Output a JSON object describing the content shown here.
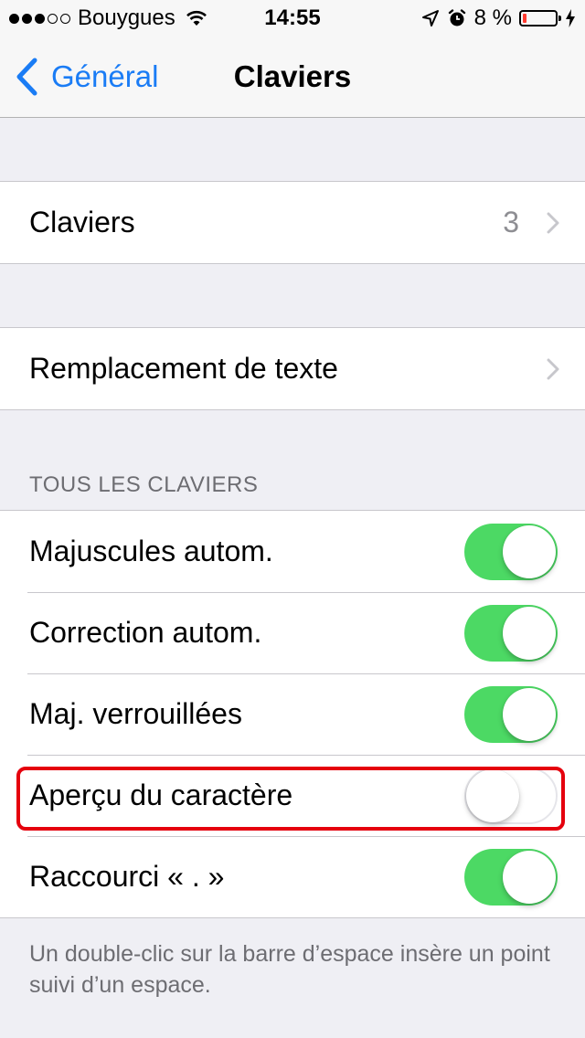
{
  "status_bar": {
    "carrier": "Bouygues",
    "signal_icon": "signal-dots-icon",
    "time": "14:55",
    "battery": "8 %",
    "battery_level": 0.08,
    "colors": {
      "battery_low": "#ff3b30"
    }
  },
  "nav": {
    "back_label": "Général",
    "title": "Claviers",
    "accent": "#1a7cf5"
  },
  "groups": {
    "keyboards": {
      "label": "Claviers",
      "detail": "3"
    },
    "replacement": {
      "label": "Remplacement de texte"
    }
  },
  "all_keyboards": {
    "header": "TOUS LES CLAVIERS",
    "toggles": [
      {
        "label": "Majuscules autom.",
        "on": true
      },
      {
        "label": "Correction autom.",
        "on": true
      },
      {
        "label": "Maj. verrouillées",
        "on": true
      },
      {
        "label": "Aperçu du caractère",
        "on": false,
        "highlighted": true
      },
      {
        "label": "Raccourci « . »",
        "on": true
      }
    ],
    "footer": "Un double-clic sur la barre d’espace insère un point suivi d’un espace."
  },
  "colors": {
    "switch_on": "#4cd964",
    "highlight": "#e5000d",
    "background": "#efeff4"
  }
}
